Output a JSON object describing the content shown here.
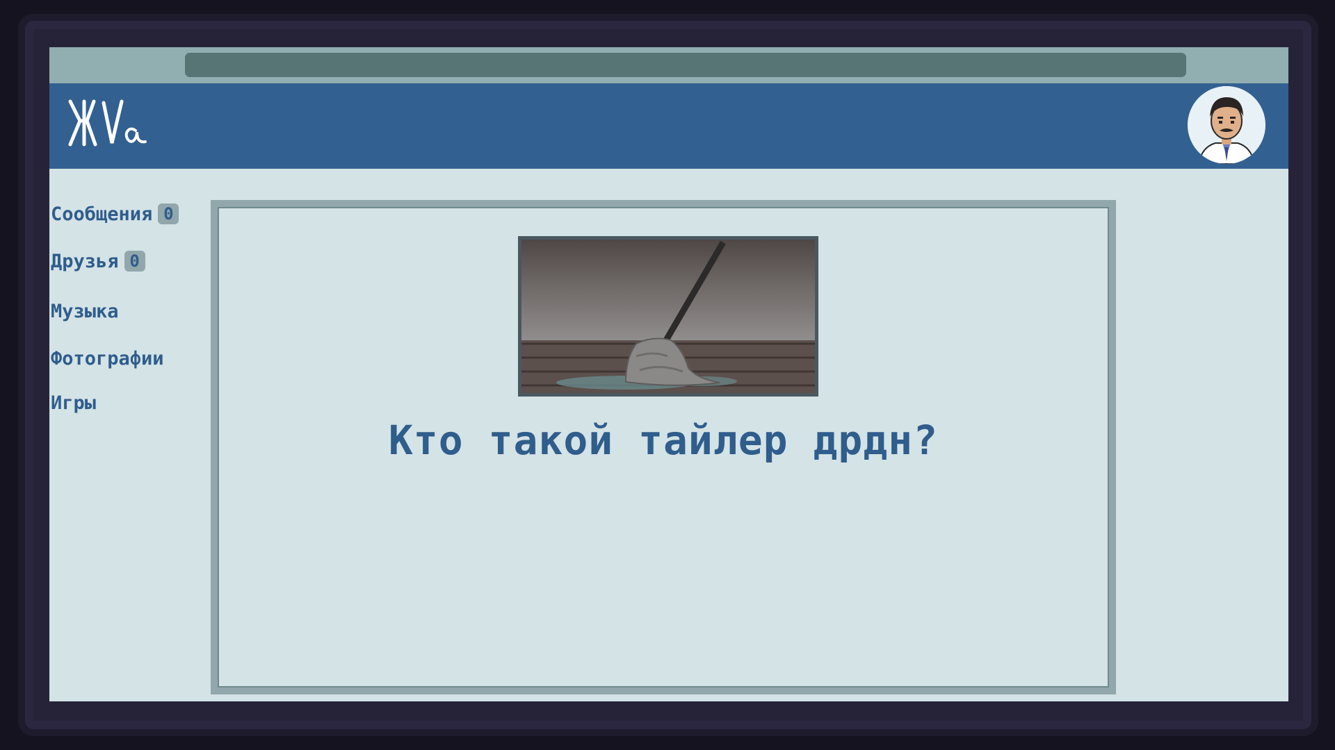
{
  "app": {
    "logo_text": "ЖVa"
  },
  "colors": {
    "header": "#326091",
    "background": "#d4e3e6",
    "text": "#2f5d8c",
    "topbar": "#91aeb0",
    "addressbar": "#587575",
    "badge": "#91a7ab"
  },
  "sidebar": {
    "items": [
      {
        "label": "Сообщения",
        "badge": "0",
        "icon": "none"
      },
      {
        "label": "Друзья",
        "badge": "0",
        "icon": "none"
      },
      {
        "label": "Музыка"
      },
      {
        "label": "Фотографии"
      },
      {
        "label": "Игры"
      }
    ]
  },
  "main": {
    "image": "mop-on-wet-floor-icon",
    "question": "Кто такой тайлер дрдн?"
  },
  "header": {
    "avatar": "man-with-mustache-avatar"
  }
}
